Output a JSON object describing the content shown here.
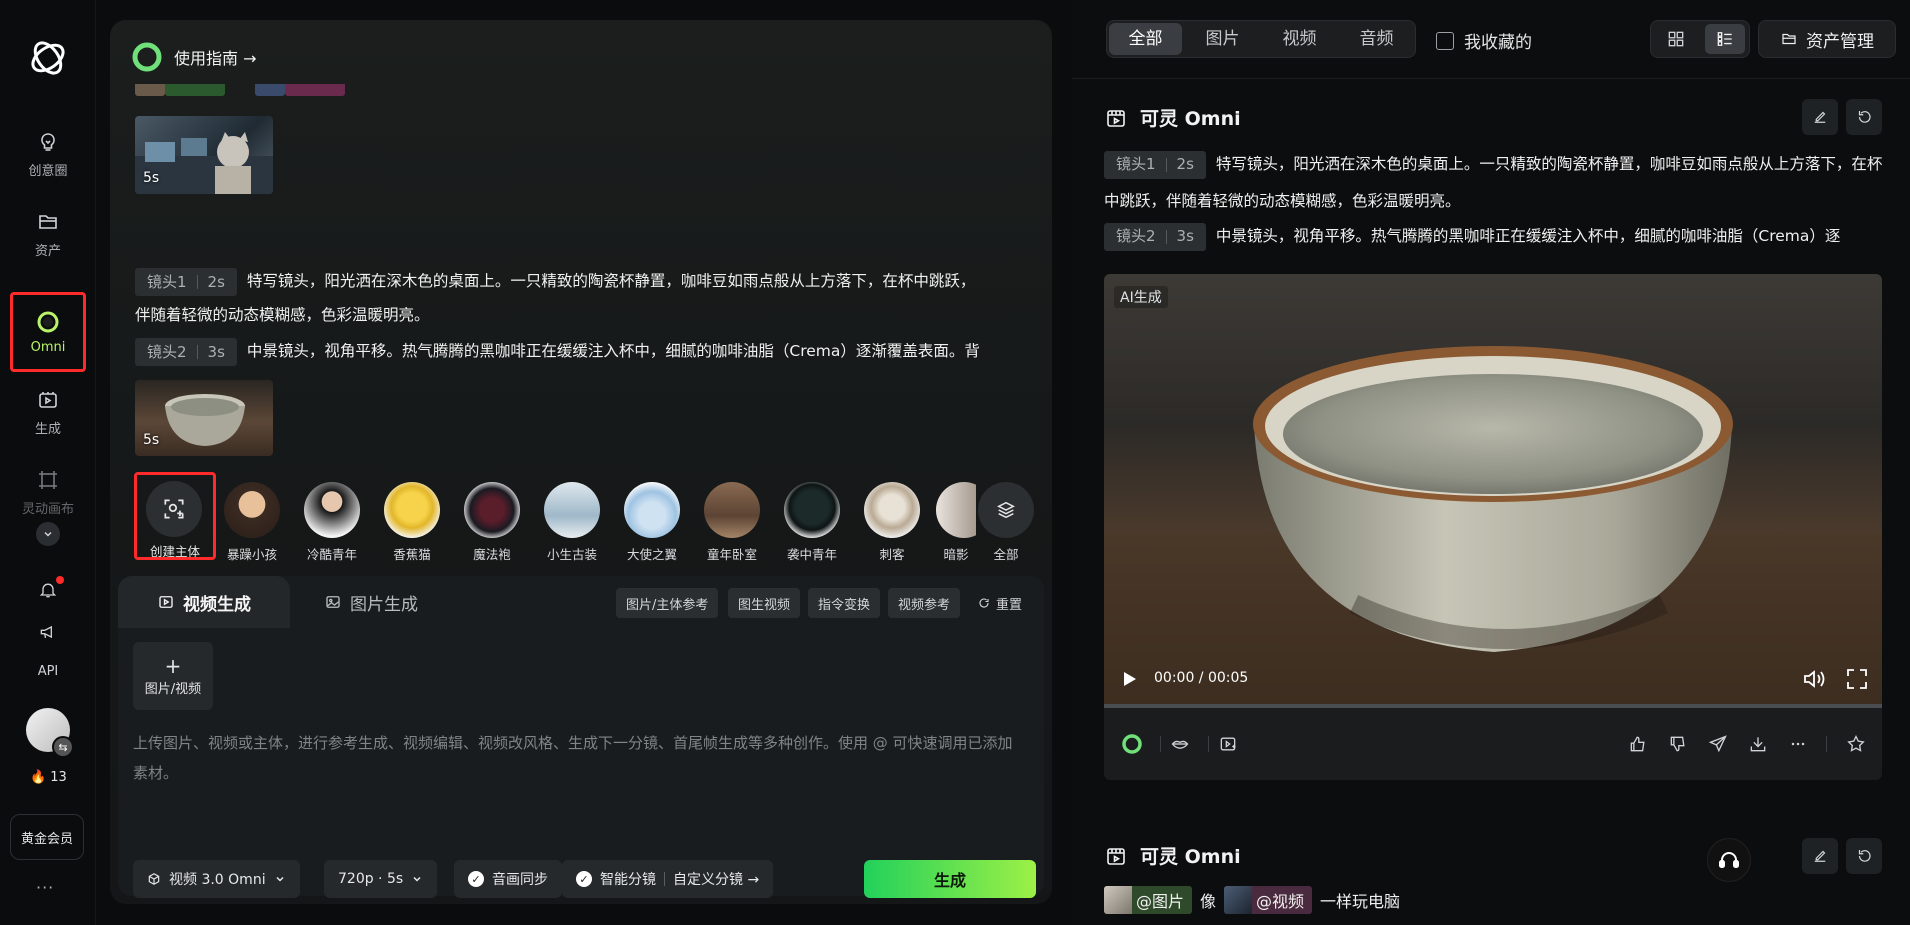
{
  "sidebar": {
    "items": [
      {
        "label": "创意圈"
      },
      {
        "label": "资产"
      },
      {
        "label": "Omni"
      },
      {
        "label": "生成"
      },
      {
        "label": "灵动画布"
      }
    ],
    "api_label": "API",
    "credits": "13",
    "vip_label": "黄金会员",
    "more": "···"
  },
  "panel": {
    "guide_label": "使用指南 →",
    "thumb1_duration": "5s",
    "thumb2_duration": "5s",
    "shots": [
      {
        "tag": "镜头1",
        "duration": "2s",
        "text_line1": "特写镜头，阳光洒在深木色的桌面上。一只精致的陶瓷杯静置，咖啡豆如雨点般从上方落下，在杯中跳跃，",
        "text_line2": "伴随着轻微的动态模糊感，色彩温暖明亮。"
      },
      {
        "tag": "镜头2",
        "duration": "3s",
        "text_line1": "中景镜头，视角平移。热气腾腾的黑咖啡正在缓缓注入杯中，细腻的咖啡油脂（Crema）逐渐覆盖表面。背"
      }
    ],
    "characters": {
      "create_label": "创建主体",
      "list": [
        "暴躁小孩",
        "冷酷青年",
        "香蕉猫",
        "魔法袍",
        "小生古装",
        "大使之翼",
        "童年卧室",
        "袭中青年",
        "刺客",
        "暗影"
      ],
      "all_label": "全部"
    },
    "tabs": {
      "video": "视频生成",
      "image": "图片生成"
    },
    "chips": [
      "图片/主体参考",
      "图生视频",
      "指令变换",
      "视频参考"
    ],
    "reset_label": "重置",
    "upload_label": "图片/视频",
    "prompt_placeholder": "上传图片、视频或主体，进行参考生成、视频编辑、视频改风格、生成下一分镜、首尾帧生成等多种创作。使用 @ 可快速调用已添加素材。",
    "controls": {
      "model": "视频 3.0 Omni",
      "resolution": "720p · 5s",
      "audio_sync": "音画同步",
      "smart_shot": "智能分镜",
      "custom_shot": "自定义分镜 →"
    },
    "generate_label": "生成"
  },
  "right": {
    "filters": [
      "全部",
      "图片",
      "视频",
      "音频"
    ],
    "active_filter": 0,
    "favorites_label": "我收藏的",
    "asset_manage_label": "资产管理",
    "result1": {
      "title": "可灵 Omni",
      "shots": [
        {
          "tag": "镜头1",
          "duration": "2s",
          "text": "特写镜头，阳光洒在深木色的桌面上。一只精致的陶瓷杯静置，咖啡豆如雨点般从上方落下，在杯中跳跃，伴随着轻微的动态模糊感，色彩温暖明亮。"
        },
        {
          "tag": "镜头2",
          "duration": "3s",
          "text": "中景镜头，视角平移。热气腾腾的黑咖啡正在缓缓注入杯中，细腻的咖啡油脂（Crema）逐"
        }
      ],
      "ai_label": "AI生成",
      "time": "00:00 / 00:05",
      "progress": 0
    },
    "result2": {
      "title": "可灵 Omni",
      "ref_image": "@图片",
      "ref_mid": "像",
      "ref_video": "@视频",
      "ref_tail": "一样玩电脑"
    }
  },
  "colors": {
    "accent_green": "#b9f36a",
    "highlight_red": "#ff2b2b",
    "generate_start": "#22d15b",
    "generate_end": "#9ef046"
  }
}
